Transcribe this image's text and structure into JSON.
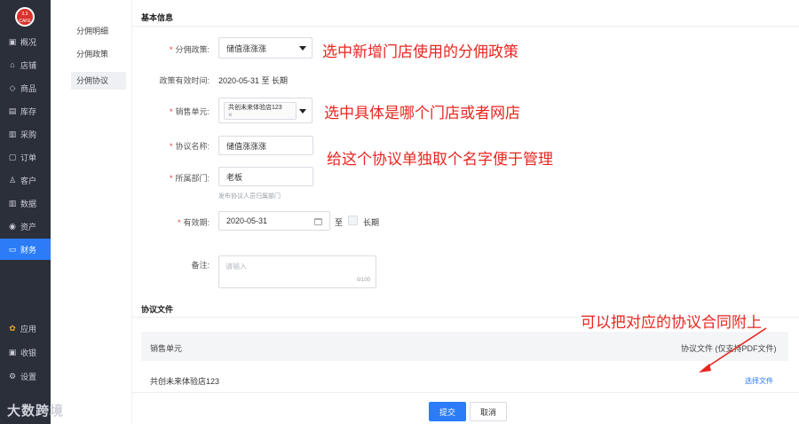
{
  "logo": {
    "line1": "3.3",
    "line2": "CAFE"
  },
  "nav": [
    {
      "icon": "dashboard-icon",
      "glyph": "▣",
      "label": "概况"
    },
    {
      "icon": "store-icon",
      "glyph": "⌂",
      "label": "店铺"
    },
    {
      "icon": "tag-icon",
      "glyph": "◇",
      "label": "商品"
    },
    {
      "icon": "inventory-icon",
      "glyph": "▤",
      "label": "库存"
    },
    {
      "icon": "purchase-icon",
      "glyph": "▥",
      "label": "采购"
    },
    {
      "icon": "order-icon",
      "glyph": "▢",
      "label": "订单"
    },
    {
      "icon": "customer-icon",
      "glyph": "♙",
      "label": "客户"
    },
    {
      "icon": "data-icon",
      "glyph": "▥",
      "label": "数据"
    },
    {
      "icon": "assets-icon",
      "glyph": "◉",
      "label": "资产"
    },
    {
      "icon": "finance-icon",
      "glyph": "▭",
      "label": "财务",
      "active": true
    }
  ],
  "nav_bottom": [
    {
      "icon": "apps-icon",
      "glyph": "✿",
      "label": "应用"
    },
    {
      "icon": "cashier-icon",
      "glyph": "▣",
      "label": "收银"
    },
    {
      "icon": "settings-icon",
      "glyph": "⚙",
      "label": "设置"
    }
  ],
  "submenu": [
    "分佣明细",
    "分佣政策",
    "分佣协议"
  ],
  "basic": {
    "title": "基本信息",
    "policy_label": "分佣政策:",
    "policy_value": "储值涨涨涨",
    "validity_label": "政策有效时间:",
    "validity_value": "2020-05-31 至 长期",
    "unit_label": "销售单元:",
    "unit_tag": "共创未来体验店123",
    "unit_tag_close": "×",
    "name_label": "协议名称:",
    "name_value": "储值涨涨涨",
    "dept_label": "所属部门:",
    "dept_value": "老板",
    "dept_hint": "发布协议人员归属部门",
    "period_label": "有效期:",
    "period_value": "2020-05-31",
    "period_to": "至",
    "period_long": "长期",
    "remark_label": "备注:",
    "remark_placeholder": "请输入",
    "remark_count": "0/100"
  },
  "files": {
    "title": "协议文件",
    "col_unit": "销售单元",
    "col_file": "协议文件 (仅支持PDF文件)",
    "row_unit": "共创未来体验店123",
    "row_action": "选择文件"
  },
  "footer": {
    "submit": "提交",
    "cancel": "取消"
  },
  "annotations": {
    "a1": "选中新增门店使用的分佣政策",
    "a2": "选中具体是哪个门店或者网店",
    "a3": "给这个协议单独取个名字便于管理",
    "a4": "可以把对应的协议合同附上"
  },
  "watermark": "大数跨境",
  "colors": {
    "accent": "#2b7cf6",
    "annotation": "#e8261f",
    "sidebar": "#2b2f3a",
    "required": "#e4393c"
  }
}
